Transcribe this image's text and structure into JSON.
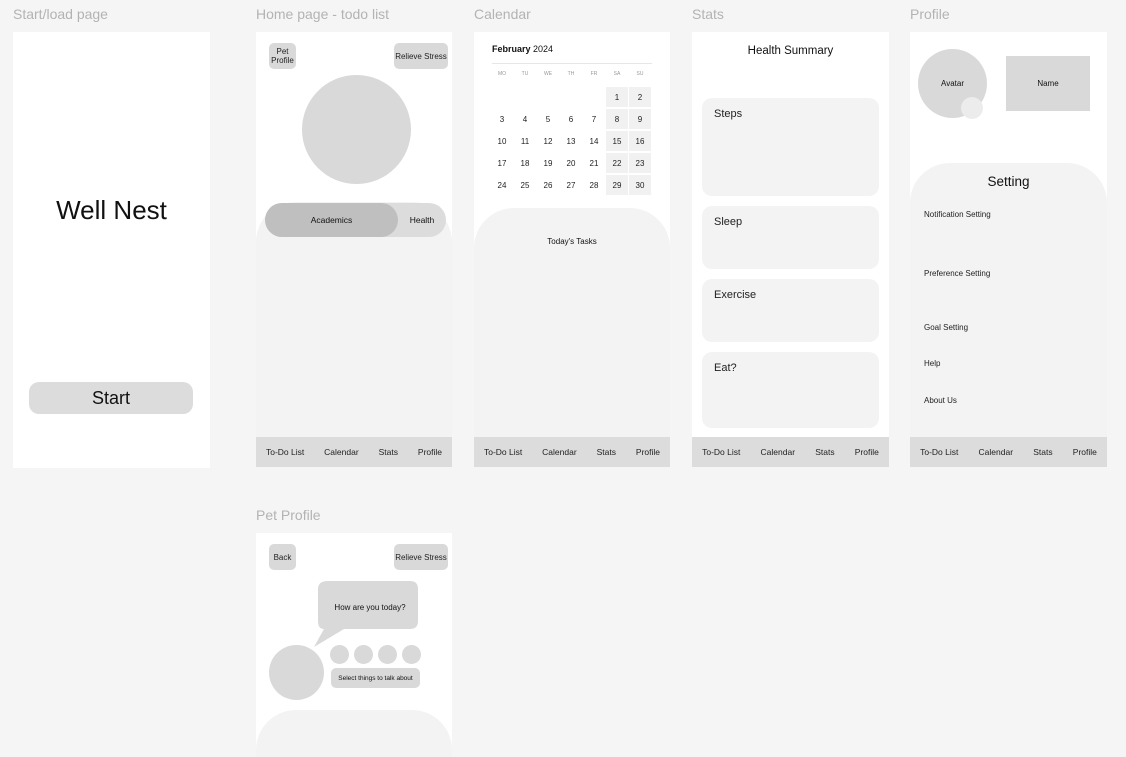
{
  "frames": {
    "start": {
      "title": "Start/load page",
      "app_name": "Well Nest",
      "start_label": "Start"
    },
    "home": {
      "title": "Home page - todo list",
      "pet_profile_label": "Pet\nProfile",
      "relieve_label": "Relieve Stress",
      "seg_academics": "Academics",
      "seg_health": "Health"
    },
    "calendar": {
      "title": "Calendar",
      "month": "February",
      "year": "2024",
      "weekdays": [
        "MO",
        "TU",
        "WE",
        "TH",
        "FR",
        "SA",
        "SU"
      ],
      "rows": [
        [
          "",
          "",
          "",
          "",
          "",
          "1",
          "2"
        ],
        [
          "3",
          "4",
          "5",
          "6",
          "7",
          "8",
          "9"
        ],
        [
          "10",
          "11",
          "12",
          "13",
          "14",
          "15",
          "16"
        ],
        [
          "17",
          "18",
          "19",
          "20",
          "21",
          "22",
          "23"
        ],
        [
          "24",
          "25",
          "26",
          "27",
          "28",
          "29",
          "30"
        ]
      ],
      "tasks_label": "Today's Tasks"
    },
    "stats": {
      "title": "Stats",
      "heading": "Health Summary",
      "cards": [
        "Steps",
        "Sleep",
        "Exercise",
        "Eat?"
      ]
    },
    "profile": {
      "title": "Profile",
      "avatar_label": "Avatar",
      "name_label": "Name",
      "setting_heading": "Setting",
      "items": [
        "Notification Setting",
        "Preference Setting",
        "Goal Setting",
        "Help",
        "About Us"
      ]
    },
    "pet": {
      "title": "Pet Profile",
      "back_label": "Back",
      "relieve_label": "Relieve Stress",
      "bubble_text": "How are you today?",
      "select_label": "Select things to talk about"
    }
  },
  "nav": {
    "todo": "To-Do List",
    "calendar": "Calendar",
    "stats": "Stats",
    "profile": "Profile"
  }
}
